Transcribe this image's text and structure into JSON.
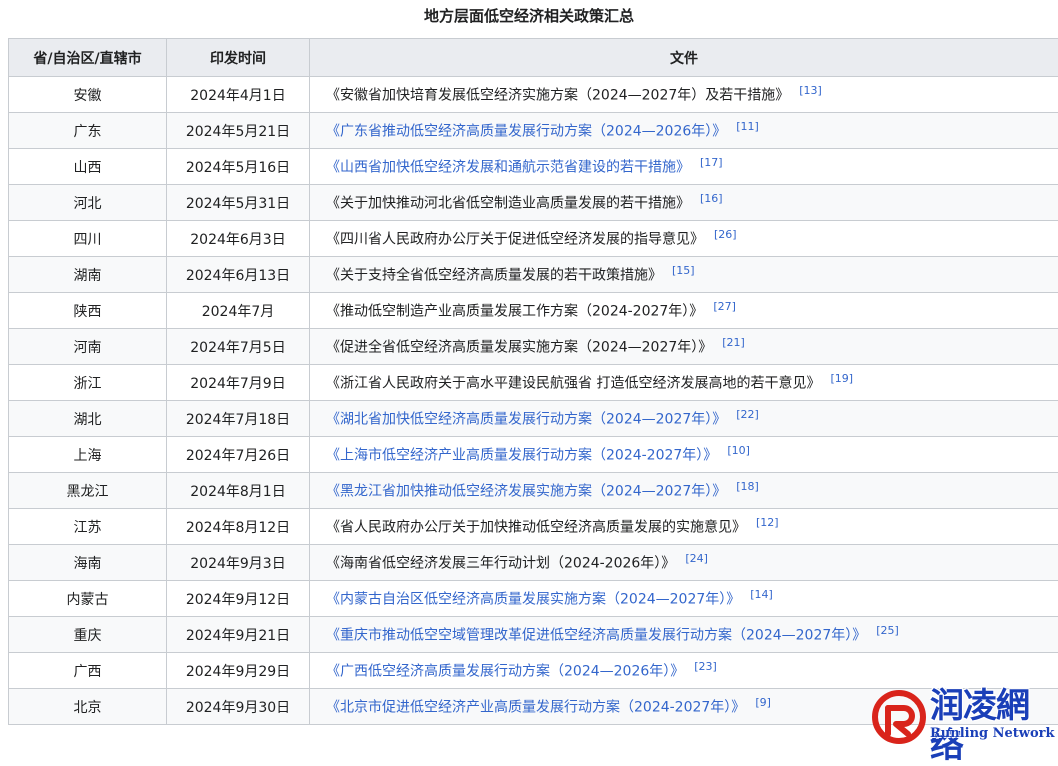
{
  "caption": "地方层面低空经济相关政策汇总",
  "headers": {
    "province": "省/自治区/直辖市",
    "date": "印发时间",
    "document": "文件"
  },
  "rows": [
    {
      "province": "安徽",
      "date": "2024年4月1日",
      "document": "《安徽省加快培育发展低空经济实施方案（2024—2027年）及若干措施》",
      "linked": false,
      "ref": "[13]"
    },
    {
      "province": "广东",
      "date": "2024年5月21日",
      "document": "《广东省推动低空经济高质量发展行动方案（2024—2026年）》",
      "linked": true,
      "ref": "[11]"
    },
    {
      "province": "山西",
      "date": "2024年5月16日",
      "document": "《山西省加快低空经济发展和通航示范省建设的若干措施》",
      "linked": true,
      "ref": "[17]"
    },
    {
      "province": "河北",
      "date": "2024年5月31日",
      "document": "《关于加快推动河北省低空制造业高质量发展的若干措施》",
      "linked": false,
      "ref": "[16]"
    },
    {
      "province": "四川",
      "date": "2024年6月3日",
      "document": "《四川省人民政府办公厅关于促进低空经济发展的指导意见》",
      "linked": false,
      "ref": "[26]"
    },
    {
      "province": "湖南",
      "date": "2024年6月13日",
      "document": "《关于支持全省低空经济高质量发展的若干政策措施》",
      "linked": false,
      "ref": "[15]"
    },
    {
      "province": "陕西",
      "date": "2024年7月",
      "document": "《推动低空制造产业高质量发展工作方案（2024-2027年）》",
      "linked": false,
      "ref": "[27]"
    },
    {
      "province": "河南",
      "date": "2024年7月5日",
      "document": "《促进全省低空经济高质量发展实施方案（2024—2027年）》",
      "linked": false,
      "ref": "[21]"
    },
    {
      "province": "浙江",
      "date": "2024年7月9日",
      "document": "《浙江省人民政府关于高水平建设民航强省 打造低空经济发展高地的若干意见》",
      "linked": false,
      "ref": "[19]"
    },
    {
      "province": "湖北",
      "date": "2024年7月18日",
      "document": "《湖北省加快低空经济高质量发展行动方案（2024—2027年）》",
      "linked": true,
      "ref": "[22]"
    },
    {
      "province": "上海",
      "date": "2024年7月26日",
      "document": "《上海市低空经济产业高质量发展行动方案（2024-2027年）》",
      "linked": true,
      "ref": "[10]"
    },
    {
      "province": "黑龙江",
      "date": "2024年8月1日",
      "document": "《黑龙江省加快推动低空经济发展实施方案（2024—2027年）》",
      "linked": true,
      "ref": "[18]"
    },
    {
      "province": "江苏",
      "date": "2024年8月12日",
      "document": "《省人民政府办公厅关于加快推动低空经济高质量发展的实施意见》",
      "linked": false,
      "ref": "[12]"
    },
    {
      "province": "海南",
      "date": "2024年9月3日",
      "document": "《海南省低空经济发展三年行动计划（2024-2026年）》",
      "linked": false,
      "ref": "[24]"
    },
    {
      "province": "内蒙古",
      "date": "2024年9月12日",
      "document": "《内蒙古自治区低空经济高质量发展实施方案（2024—2027年）》",
      "linked": true,
      "ref": "[14]"
    },
    {
      "province": "重庆",
      "date": "2024年9月21日",
      "document": "《重庆市推动低空空域管理改革促进低空经济高质量发展行动方案（2024—2027年）》",
      "linked": true,
      "ref": "[25]"
    },
    {
      "province": "广西",
      "date": "2024年9月29日",
      "document": "《广西低空经济高质量发展行动方案（2024—2026年）》",
      "linked": true,
      "ref": "[23]"
    },
    {
      "province": "北京",
      "date": "2024年9月30日",
      "document": "《北京市促进低空经济产业高质量发展行动方案（2024-2027年）》",
      "linked": true,
      "ref": "[9]"
    }
  ],
  "watermark": {
    "title": "润凌網络",
    "subtitle": "Runling Network",
    "colors": {
      "logo_red": "#d9241b",
      "text_blue": "#1a3fb8"
    },
    "logo_icon": "runling-logo-icon"
  },
  "colors": {
    "link": "#3366cc",
    "header_bg": "#eaecf0",
    "border": "#c8ccd1",
    "stripe": "#f8f9fa"
  }
}
